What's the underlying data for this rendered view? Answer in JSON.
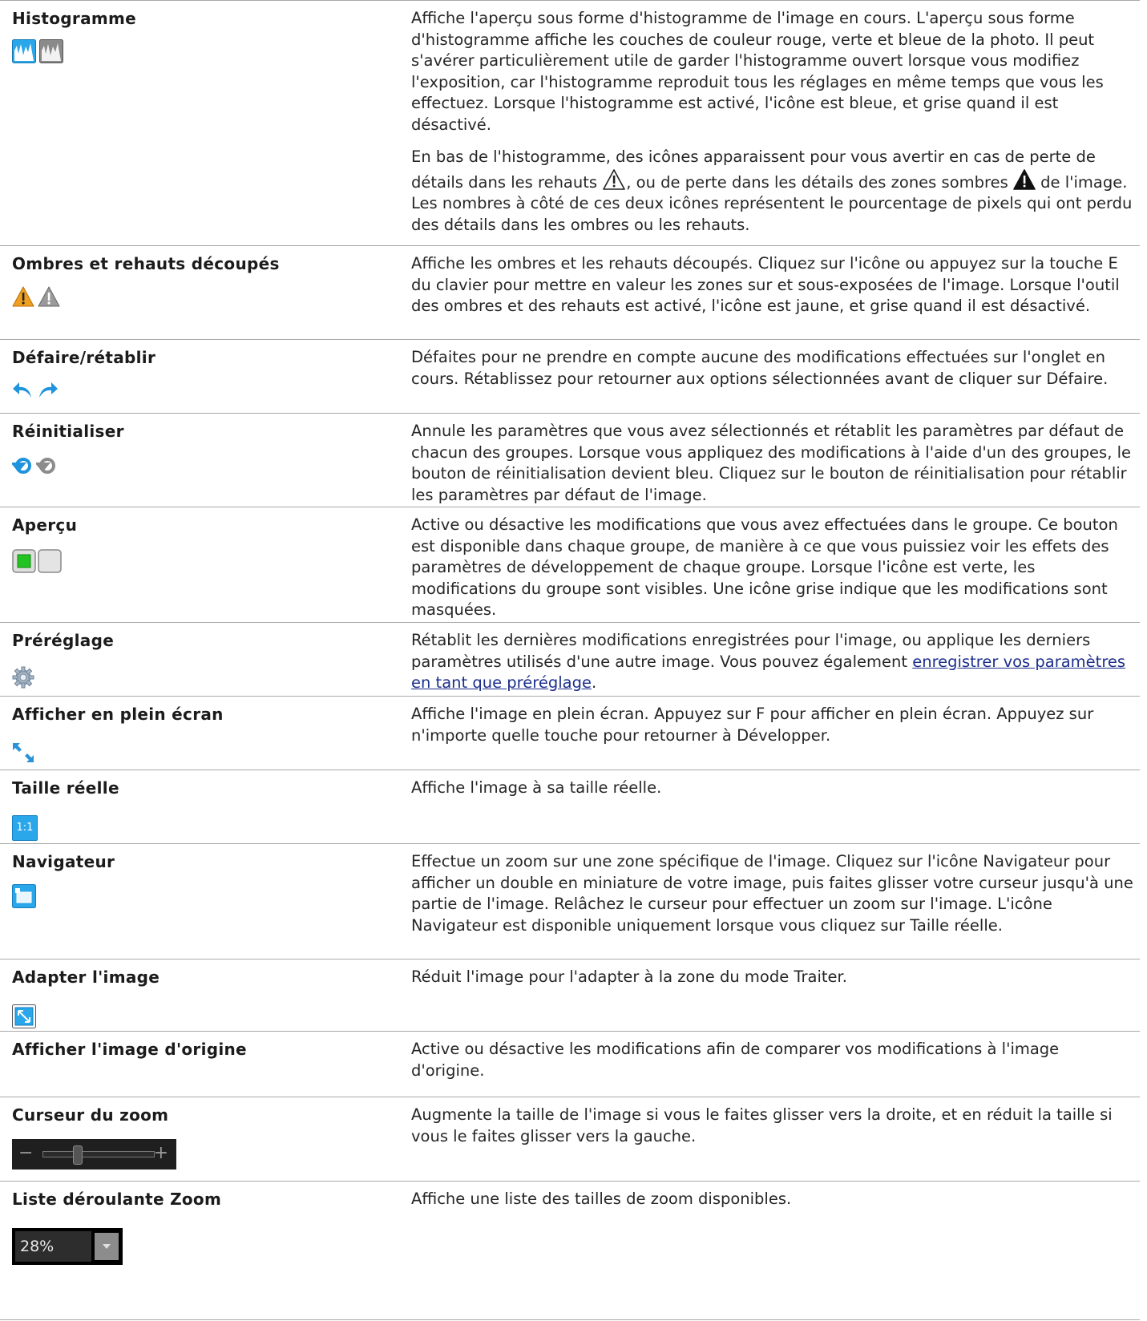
{
  "rows": [
    {
      "name": "Histogramme",
      "desc1": "Affiche l'aperçu sous forme d'histogramme de l'image en cours. L'aperçu sous forme d'histogramme affiche les couches de couleur rouge, verte et bleue de la photo. Il peut s'avérer particulièrement utile de garder l'histogramme ouvert lorsque vous modifiez l'exposition, car l'histogramme reproduit tous les réglages en même temps que vous les effectuez. Lorsque l'histogramme est activé, l'icône est bleue, et grise quand il est désactivé.",
      "desc2a": "En bas de l'histogramme, des icônes apparaissent pour vous avertir en cas de perte de détails dans les rehauts ",
      "desc2b": ", ou de perte dans les détails des zones sombres ",
      "desc2c": " de l'image. Les nombres à côté de ces deux icônes représentent le pourcentage de pixels qui ont perdu des détails dans les ombres ou les rehauts.",
      "icons": [
        "histogram-on-icon",
        "histogram-off-icon"
      ]
    },
    {
      "name": "Ombres et rehauts découpés",
      "desc": "Affiche les ombres et les rehauts découpés. Cliquez sur l'icône ou appuyez sur la touche E du clavier pour mettre en valeur les zones sur et sous-exposées de l'image. Lorsque l'outil des ombres et des rehauts est activé, l'icône est jaune, et grise quand il est désactivé.",
      "icons": [
        "warning-yellow-icon",
        "warning-gray-icon"
      ]
    },
    {
      "name": "Défaire/rétablir",
      "desc": "Défaites pour ne prendre en compte aucune des modifications effectuées sur l'onglet en cours. Rétablissez pour retourner aux options sélectionnées avant de cliquer sur Défaire.",
      "icons": [
        "undo-icon",
        "redo-icon"
      ]
    },
    {
      "name": "Réinitialiser",
      "desc": "Annule les paramètres que vous avez sélectionnés et rétablit les paramètres par défaut de chacun des groupes. Lorsque vous appliquez des modifications à l'aide d'un des groupes, le bouton de réinitialisation devient bleu. Cliquez sur le bouton de réinitialisation pour rétablir les paramètres par défaut de l'image.",
      "icons": [
        "reset-blue-icon",
        "reset-gray-icon"
      ]
    },
    {
      "name": "Aperçu",
      "desc": "Active ou désactive les modifications que vous avez effectuées dans le groupe. Ce bouton est disponible dans chaque groupe, de manière à ce que vous puissiez voir les effets des paramètres de développement de chaque groupe. Lorsque l'icône est verte, les modifications du groupe sont visibles. Une icône grise indique que les modifications sont masquées.",
      "icons": [
        "preview-on-icon",
        "preview-off-icon"
      ]
    },
    {
      "name": "Préréglage",
      "desc": "Rétablit les dernières modifications enregistrées pour l'image, ou applique les derniers paramètres utilisés d'une autre image. Vous pouvez également ",
      "link": "enregistrer vos paramètres en tant que préréglage",
      "desc_after": ".",
      "icons": [
        "preset-gear-icon"
      ]
    },
    {
      "name": "Afficher en plein écran",
      "desc": "Affiche l'image en plein écran. Appuyez sur F pour afficher en plein écran. Appuyez sur n'importe quelle touche pour retourner à Développer.",
      "icons": [
        "fullscreen-icon"
      ]
    },
    {
      "name": "Taille réelle",
      "desc": "Affiche l'image à sa taille réelle.",
      "icon_text": "1:1",
      "icons": [
        "actual-size-icon"
      ]
    },
    {
      "name": "Navigateur",
      "desc": "Effectue un zoom sur une zone spécifique de l'image. Cliquez sur l'icône Navigateur pour afficher un double en miniature de votre image, puis faites glisser votre curseur jusqu'à une partie de l'image. Relâchez le curseur pour effectuer un zoom sur l'image. L'icône Navigateur est disponible uniquement lorsque vous cliquez sur Taille réelle.",
      "icons": [
        "navigator-icon"
      ]
    },
    {
      "name": "Adapter l'image",
      "desc": "Réduit l'image pour l'adapter à la zone du mode Traiter.",
      "icons": [
        "fit-image-icon"
      ]
    },
    {
      "name": "Afficher l'image d'origine",
      "desc": "Active ou désactive les modifications afin de comparer vos modifications à l'image d'origine.",
      "icons": []
    },
    {
      "name": "Curseur du zoom",
      "desc": "Augmente la taille de l'image si vous le faites glisser vers la droite, et en réduit la taille si vous le faites glisser vers la gauche.",
      "slider_minus": "−",
      "slider_plus": "+",
      "slider_position": 0.3,
      "icons": [
        "zoom-slider"
      ]
    },
    {
      "name": "Liste déroulante Zoom",
      "desc": "Affiche une liste des tailles de zoom disponibles.",
      "zoom_value": "28%",
      "icons": [
        "zoom-dropdown"
      ]
    }
  ],
  "colors": {
    "icon_blue": "#29a3e6",
    "icon_gray": "#8f8f8f",
    "warning_yellow": "#f0a020",
    "preview_green": "#22c322",
    "link": "#1c2f8c"
  }
}
